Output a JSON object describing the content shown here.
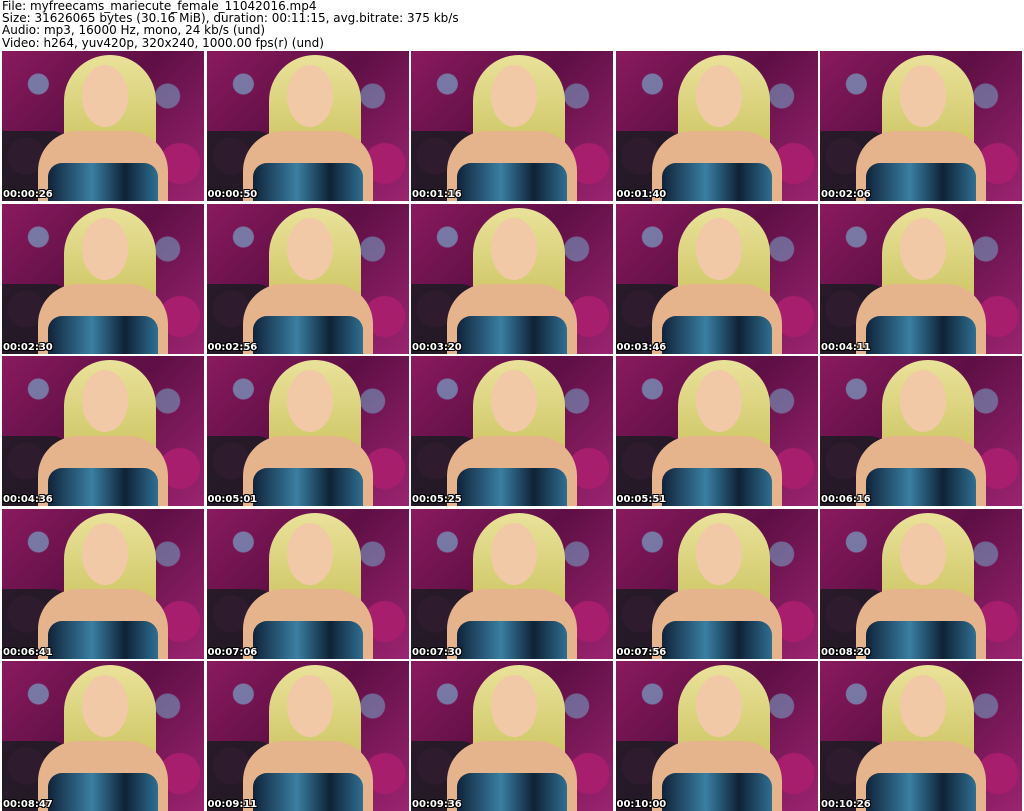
{
  "header": {
    "file": "File: myfreecams_mariecute_female_11042016.mp4",
    "size": "Size: 31626065 bytes (30.16 MiB), duration: 00:11:15, avg.bitrate: 375 kb/s",
    "audio": "Audio: mp3, 16000 Hz, mono, 24 kb/s (und)",
    "video": "Video: h264, yuv420p, 320x240, 1000.00 fps(r) (und)"
  },
  "thumbnails": [
    {
      "timestamp": "00:00:26"
    },
    {
      "timestamp": "00:00:50"
    },
    {
      "timestamp": "00:01:16"
    },
    {
      "timestamp": "00:01:40"
    },
    {
      "timestamp": "00:02:06"
    },
    {
      "timestamp": "00:02:30"
    },
    {
      "timestamp": "00:02:56"
    },
    {
      "timestamp": "00:03:20"
    },
    {
      "timestamp": "00:03:46"
    },
    {
      "timestamp": "00:04:11"
    },
    {
      "timestamp": "00:04:36"
    },
    {
      "timestamp": "00:05:01"
    },
    {
      "timestamp": "00:05:25"
    },
    {
      "timestamp": "00:05:51"
    },
    {
      "timestamp": "00:06:16"
    },
    {
      "timestamp": "00:06:41"
    },
    {
      "timestamp": "00:07:06"
    },
    {
      "timestamp": "00:07:30"
    },
    {
      "timestamp": "00:07:56"
    },
    {
      "timestamp": "00:08:20"
    },
    {
      "timestamp": "00:08:47"
    },
    {
      "timestamp": "00:09:11"
    },
    {
      "timestamp": "00:09:36"
    },
    {
      "timestamp": "00:10:00"
    },
    {
      "timestamp": "00:10:26"
    }
  ],
  "colors": {
    "background": "#ffffff",
    "header_text": "#000000",
    "timestamp_text": "#ffffff",
    "backdrop_magenta": "#8a1a5e",
    "hair_blonde": "#e9e29a",
    "top_teal": "#3a7fa2"
  }
}
